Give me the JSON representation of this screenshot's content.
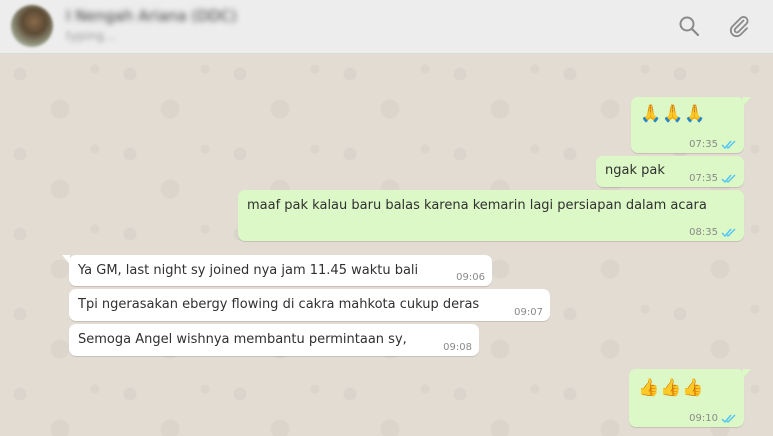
{
  "header": {
    "contact_name": "I Nengah Ariana (DDC)",
    "contact_status": "typing..."
  },
  "icons": {
    "search": "search-icon",
    "attach": "paperclip-icon",
    "read_receipt": "double-check-icon"
  },
  "colors": {
    "outgoing_bubble": "#dcf8c6",
    "incoming_bubble": "#ffffff",
    "read_ticks": "#4fc3f7",
    "header_bg": "#ededed"
  },
  "messages": [
    {
      "direction": "out",
      "text": "🙏🙏🙏",
      "time": "07:35",
      "read": true
    },
    {
      "direction": "out",
      "text": "ngak pak",
      "time": "07:35",
      "read": true
    },
    {
      "direction": "out",
      "text": "maaf pak kalau baru balas karena kemarin lagi persiapan dalam acara",
      "time": "08:35",
      "read": true
    },
    {
      "direction": "in",
      "text": "Ya GM,  last night sy joined nya jam 11.45 waktu bali",
      "time": "09:06"
    },
    {
      "direction": "in",
      "text": "Tpi ngerasakan ebergy flowing di cakra mahkota cukup deras",
      "time": "09:07"
    },
    {
      "direction": "in",
      "text": "Semoga Angel wishnya membantu permintaan sy,",
      "time": "09:08"
    },
    {
      "direction": "out",
      "text": "👍👍👍",
      "time": "09:10",
      "read": true
    }
  ]
}
